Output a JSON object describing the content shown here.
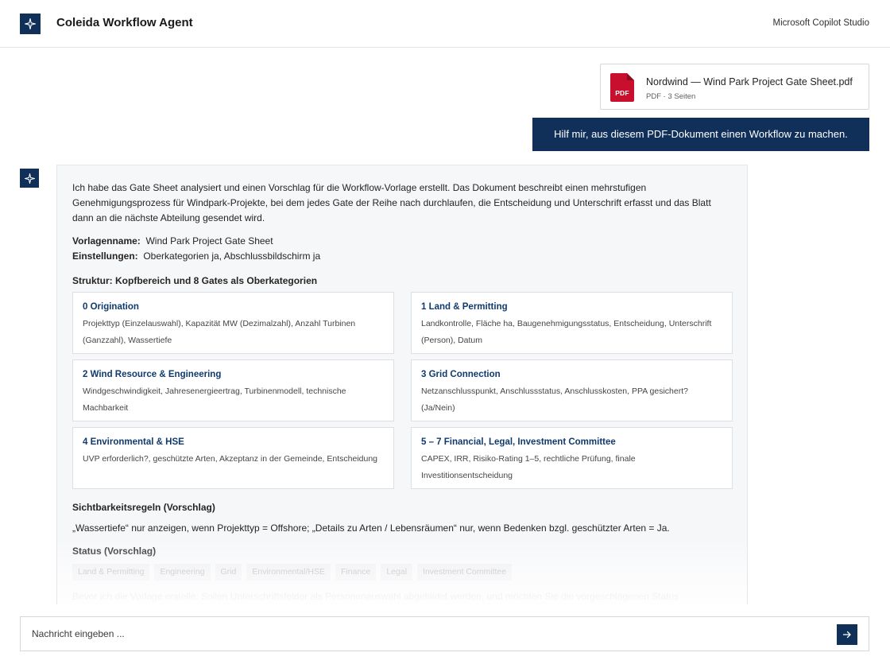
{
  "header": {
    "title": "Coleida Workflow Agent",
    "platform": "Microsoft Copilot Studio",
    "brand_icon": "sparkle-icon"
  },
  "attachment": {
    "icon": "pdf-file-icon",
    "icon_label": "PDF",
    "file_name": "Nordwind — Wind Park Project Gate Sheet.pdf",
    "meta": "PDF · 3 Seiten"
  },
  "user_message": {
    "text": "Hilf mir, aus diesem PDF-Dokument einen Workflow zu machen."
  },
  "bot_message": {
    "intro": "Ich habe das Gate Sheet analysiert und einen Vorschlag für die Workflow-Vorlage erstellt. Das Dokument beschreibt einen mehrstufigen Genehmigungsprozess für Windpark-Projekte, bei dem jedes Gate der Reihe nach durchlaufen, die Entscheidung und Unterschrift erfasst und das Blatt dann an die nächste Abteilung gesendet wird.",
    "template_name_label": "Vorlagenname:",
    "template_name_value": "Wind Park Project Gate Sheet",
    "settings_label": "Einstellungen:",
    "settings_value": "Oberkategorien ja, Abschlussbildschirm ja",
    "structure_title": "Struktur: Kopfbereich und 8 Gates als Oberkategorien",
    "gates": [
      {
        "title": "0 Origination",
        "desc": "Projekttyp (Einzelauswahl), Kapazität MW (Dezimalzahl), Anzahl Turbinen (Ganzzahl), Wassertiefe"
      },
      {
        "title": "1 Land & Permitting",
        "desc": "Landkontrolle, Fläche ha, Baugenehmigungsstatus, Entscheidung, Unterschrift (Person), Datum"
      },
      {
        "title": "2 Wind Resource & Engineering",
        "desc": "Windgeschwindigkeit, Jahresenergieertrag, Turbinenmodell, technische Machbarkeit"
      },
      {
        "title": "3 Grid Connection",
        "desc": "Netzanschlusspunkt, Anschlussstatus, Anschlusskosten, PPA gesichert? (Ja/Nein)"
      },
      {
        "title": "4 Environmental & HSE",
        "desc": "UVP erforderlich?, geschützte Arten, Akzeptanz in der Gemeinde, Entscheidung"
      },
      {
        "title": "5 – 7 Financial, Legal, Investment Committee",
        "desc": "CAPEX, IRR, Risiko-Rating 1–5, rechtliche Prüfung, finale Investitionsentscheidung"
      }
    ],
    "visibility_title": "Sichtbarkeitsregeln (Vorschlag)",
    "visibility_text": "„Wassertiefe“ nur anzeigen, wenn Projekttyp = Offshore; „Details zu Arten / Lebensräumen“ nur, wenn Bedenken bzgl. geschützter Arten = Ja.",
    "status_title": "Status (Vorschlag)",
    "status_chips": [
      "Land & Permitting",
      "Engineering",
      "Grid",
      "Environmental/HSE",
      "Finance",
      "Legal",
      "Investment Committee"
    ],
    "trailing_text": "Bevor ich die Vorlage erstelle: Sollen Unterschriftsfelder als Personenauswahl abgebildet werden, und möchten Sie die vorgeschlagenen Status"
  },
  "composer": {
    "placeholder": "Nachricht eingeben ...",
    "send_icon": "arrow-right-icon"
  },
  "colors": {
    "brand": "#10305a",
    "gate_title": "#103a6e",
    "pdf_red": "#c8102e"
  }
}
